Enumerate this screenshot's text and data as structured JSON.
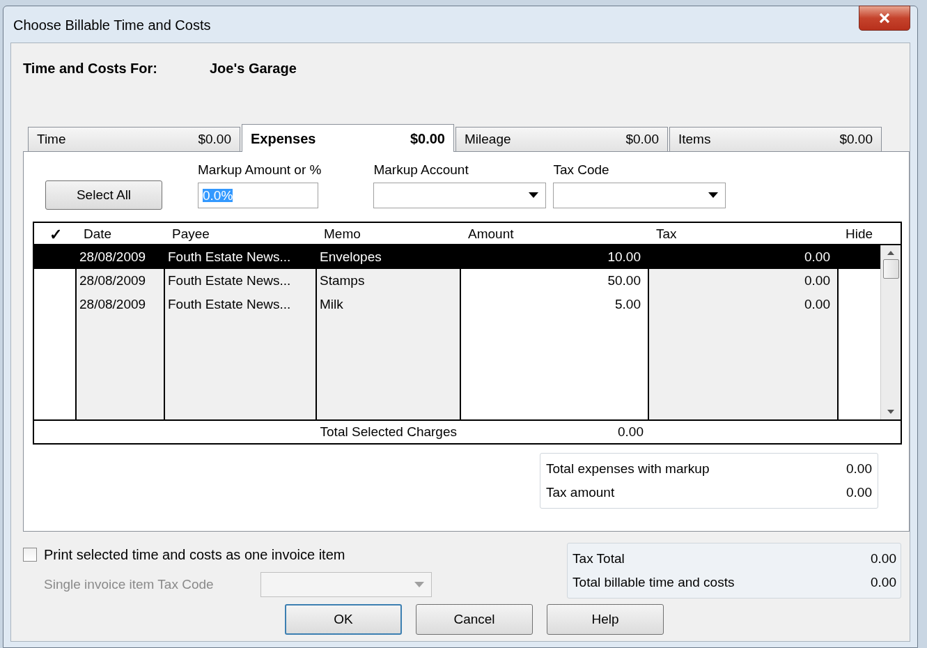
{
  "window": {
    "title": "Choose Billable Time and Costs"
  },
  "header": {
    "label": "Time and Costs For:",
    "customer": "Joe's Garage"
  },
  "tabs": [
    {
      "label": "Time",
      "amount": "$0.00",
      "selected": false
    },
    {
      "label": "Expenses",
      "amount": "$0.00",
      "selected": true
    },
    {
      "label": "Mileage",
      "amount": "$0.00",
      "selected": false
    },
    {
      "label": "Items",
      "amount": "$0.00",
      "selected": false
    }
  ],
  "select_all": "Select All",
  "markup_amount": {
    "label": "Markup Amount or %",
    "value": "0.0%"
  },
  "markup_account": {
    "label": "Markup Account"
  },
  "tax_code": {
    "label": "Tax Code"
  },
  "table": {
    "columns": [
      "✓",
      "Date",
      "Payee",
      "Memo",
      "Amount",
      "Tax",
      "Hide"
    ],
    "rows": [
      {
        "date": "28/08/2009",
        "payee": "Fouth Estate News...",
        "memo": "Envelopes",
        "amount": "10.00",
        "tax": "0.00",
        "selected": true
      },
      {
        "date": "28/08/2009",
        "payee": "Fouth Estate News...",
        "memo": "Stamps",
        "amount": "50.00",
        "tax": "0.00",
        "selected": false
      },
      {
        "date": "28/08/2009",
        "payee": "Fouth Estate News...",
        "memo": "Milk",
        "amount": "5.00",
        "tax": "0.00",
        "selected": false
      }
    ],
    "total": {
      "label": "Total Selected Charges",
      "value": "0.00"
    }
  },
  "summary": [
    {
      "label": "Total expenses with markup",
      "value": "0.00"
    },
    {
      "label": "Tax amount",
      "value": "0.00"
    }
  ],
  "print_one_item": {
    "label": "Print selected time and costs as one invoice item",
    "checked": false
  },
  "single_tax_code": {
    "label": "Single invoice item Tax Code",
    "disabled": true
  },
  "totals": [
    {
      "label": "Tax Total",
      "value": "0.00"
    },
    {
      "label": "Total billable time and costs",
      "value": "0.00"
    }
  ],
  "buttons": [
    {
      "label": "OK",
      "default": true
    },
    {
      "label": "Cancel",
      "default": false
    },
    {
      "label": "Help",
      "default": false
    }
  ]
}
